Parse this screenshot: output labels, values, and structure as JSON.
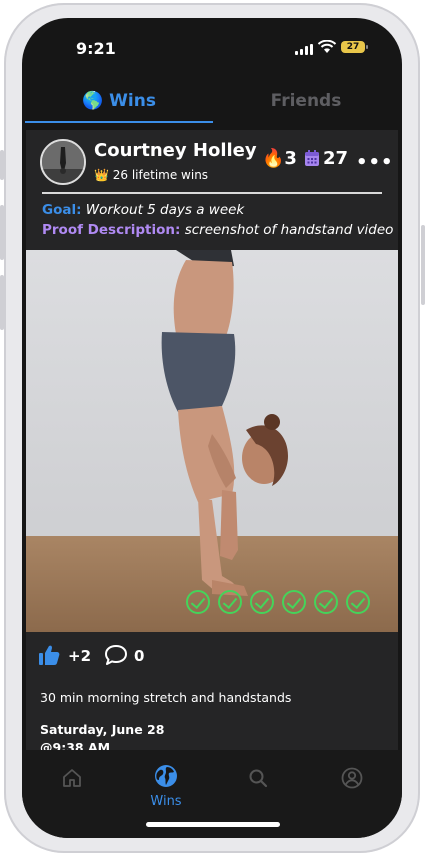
{
  "status_bar": {
    "time": "9:21",
    "battery": "27"
  },
  "tabs": [
    {
      "label": "🌎 Wins",
      "active": true
    },
    {
      "label": "Friends",
      "active": false
    }
  ],
  "post": {
    "user_name": "Courtney Holley",
    "lifetime_wins": "👑 26 lifetime wins",
    "streak": "🔥3",
    "calendar_count": "27",
    "more": "•••",
    "goal_label": "Goal:",
    "goal_value": "Workout 5 days a week",
    "proof_label": "Proof Description:",
    "proof_value": "screenshot of handstand video",
    "checks_count": 6,
    "likes": "+2",
    "comments": "0",
    "description": "30 min morning stretch and handstands",
    "date": "Saturday, June 28",
    "time": "@9:38 AM"
  },
  "nav": {
    "wins_label": "Wins"
  },
  "colors": {
    "accent": "#3b8ee8",
    "proof_label": "#b08af3",
    "check": "#45d45a",
    "background": "#161616",
    "card": "#252526"
  }
}
